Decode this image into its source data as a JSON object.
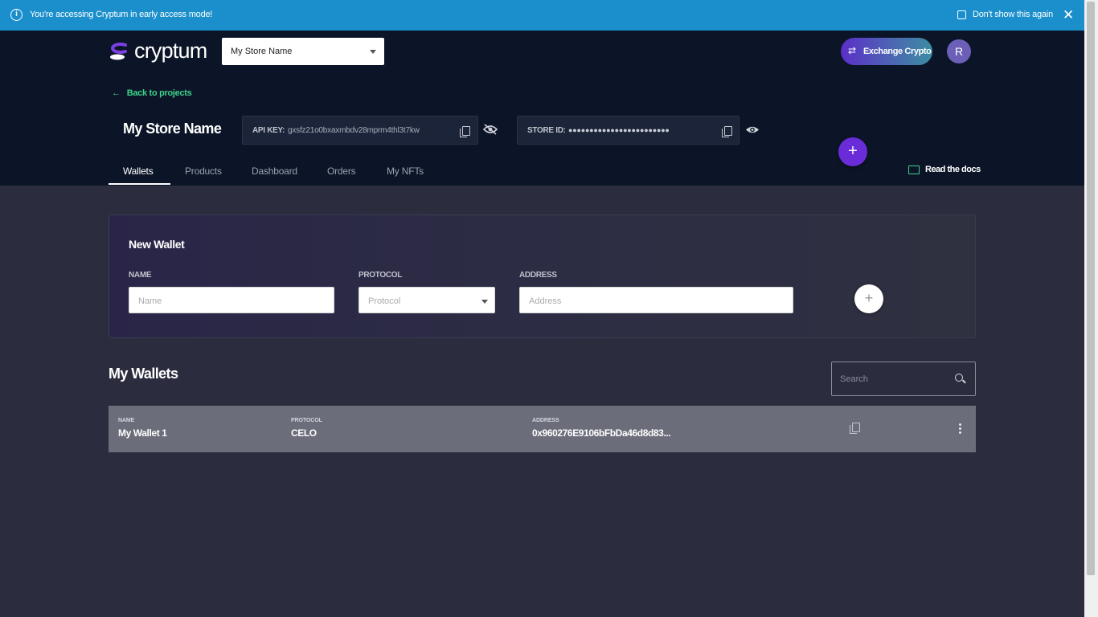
{
  "banner": {
    "message": "You're accessing Cryptum in early access mode!",
    "checkbox_label": "Don't show this again",
    "close": "✕",
    "info": "i"
  },
  "header": {
    "logo_text": "cryptum",
    "store_selector": "My Store Name",
    "exchange_label": "Exchange Crypto",
    "avatar_initial": "R"
  },
  "project": {
    "back_label": "Back to projects",
    "title": "My Store Name",
    "api_key_label": "API KEY:",
    "api_key_value": "gxsfz21o0bxaxmbdv28mprm4thl3t7kw",
    "store_id_label": "STORE ID:",
    "store_id_value": "●●●●●●●●●●●●●●●●●●●●●●●●"
  },
  "tabs": [
    {
      "label": "Wallets",
      "active": true
    },
    {
      "label": "Products",
      "active": false
    },
    {
      "label": "Dashboard",
      "active": false
    },
    {
      "label": "Orders",
      "active": false
    },
    {
      "label": "My NFTs",
      "active": false
    }
  ],
  "docs_label": "Read the docs",
  "new_wallet": {
    "title": "New Wallet",
    "name_label": "NAME",
    "name_placeholder": "Name",
    "protocol_label": "PROTOCOL",
    "protocol_placeholder": "Protocol",
    "address_label": "ADDRESS",
    "address_placeholder": "Address"
  },
  "my_wallets": {
    "title": "My Wallets",
    "search_placeholder": "Search",
    "columns": {
      "name": "NAME",
      "protocol": "PROTOCOL",
      "address": "ADDRESS"
    },
    "rows": [
      {
        "name": "My Wallet 1",
        "protocol": "CELO",
        "address": "0x960276E9106bFbDa46d8d83..."
      }
    ]
  },
  "colors": {
    "banner": "#1a8fcc",
    "header": "#0b1527",
    "accent_green": "#3dd28c",
    "accent_purple": "#6a2cd8",
    "body": "#2b2d3e"
  }
}
